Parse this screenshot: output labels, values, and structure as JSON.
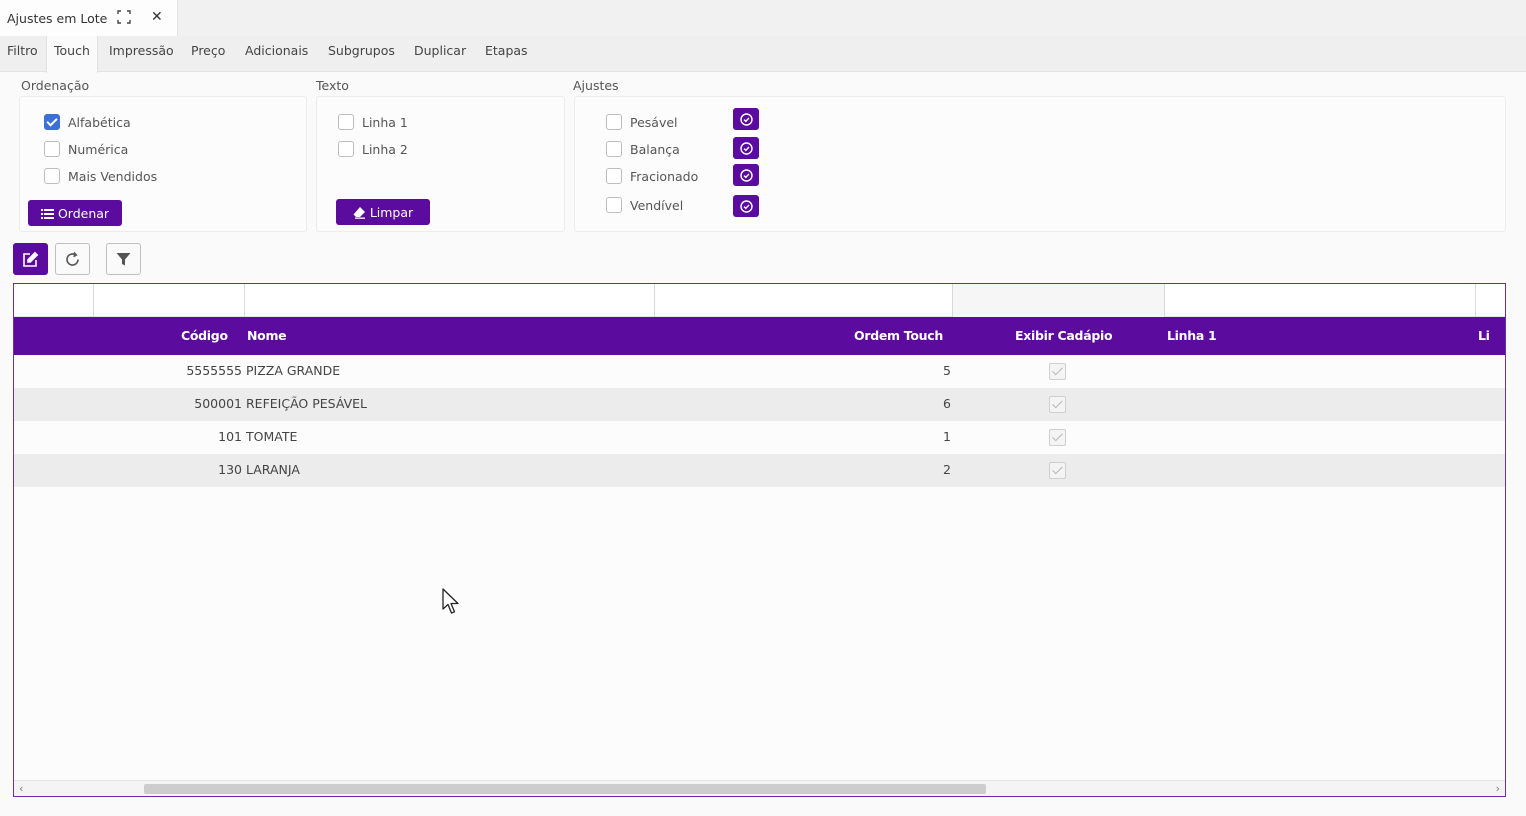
{
  "window": {
    "title": "Ajustes em Lote"
  },
  "tabs": [
    {
      "label": "Filtro"
    },
    {
      "label": "Touch"
    },
    {
      "label": "Impressão"
    },
    {
      "label": "Preço"
    },
    {
      "label": "Adicionais"
    },
    {
      "label": "Subgrupos"
    },
    {
      "label": "Duplicar"
    },
    {
      "label": "Etapas"
    }
  ],
  "active_tab": "Touch",
  "ordenacao": {
    "label": "Ordenação",
    "options": [
      {
        "label": "Alfabética",
        "checked": true
      },
      {
        "label": "Numérica",
        "checked": false
      },
      {
        "label": "Mais Vendidos",
        "checked": false
      }
    ],
    "button": "Ordenar"
  },
  "texto": {
    "label": "Texto",
    "options": [
      {
        "label": "Linha 1",
        "checked": false
      },
      {
        "label": "Linha 2",
        "checked": false
      }
    ],
    "button": "Limpar"
  },
  "ajustes": {
    "label": "Ajustes",
    "options": [
      {
        "label": "Pesável",
        "checked": false
      },
      {
        "label": "Balança",
        "checked": false
      },
      {
        "label": "Fracionado",
        "checked": false
      },
      {
        "label": "Vendível",
        "checked": false
      }
    ]
  },
  "grid": {
    "columns": [
      "Código",
      "Nome",
      "Ordem Touch",
      "Exibir Cadápio",
      "Linha 1",
      "Li"
    ],
    "rows": [
      {
        "codigo": "5555555",
        "nome": "PIZZA GRANDE",
        "ordem": "5",
        "exibir": true
      },
      {
        "codigo": "500001",
        "nome": "REFEIÇÃO PESÁVEL",
        "ordem": "6",
        "exibir": true
      },
      {
        "codigo": "101",
        "nome": "TOMATE",
        "ordem": "1",
        "exibir": true
      },
      {
        "codigo": "130",
        "nome": "LARANJA",
        "ordem": "2",
        "exibir": true
      }
    ]
  },
  "colors": {
    "primary": "#5b0c9e",
    "checkbox_on": "#3d6fd8"
  }
}
